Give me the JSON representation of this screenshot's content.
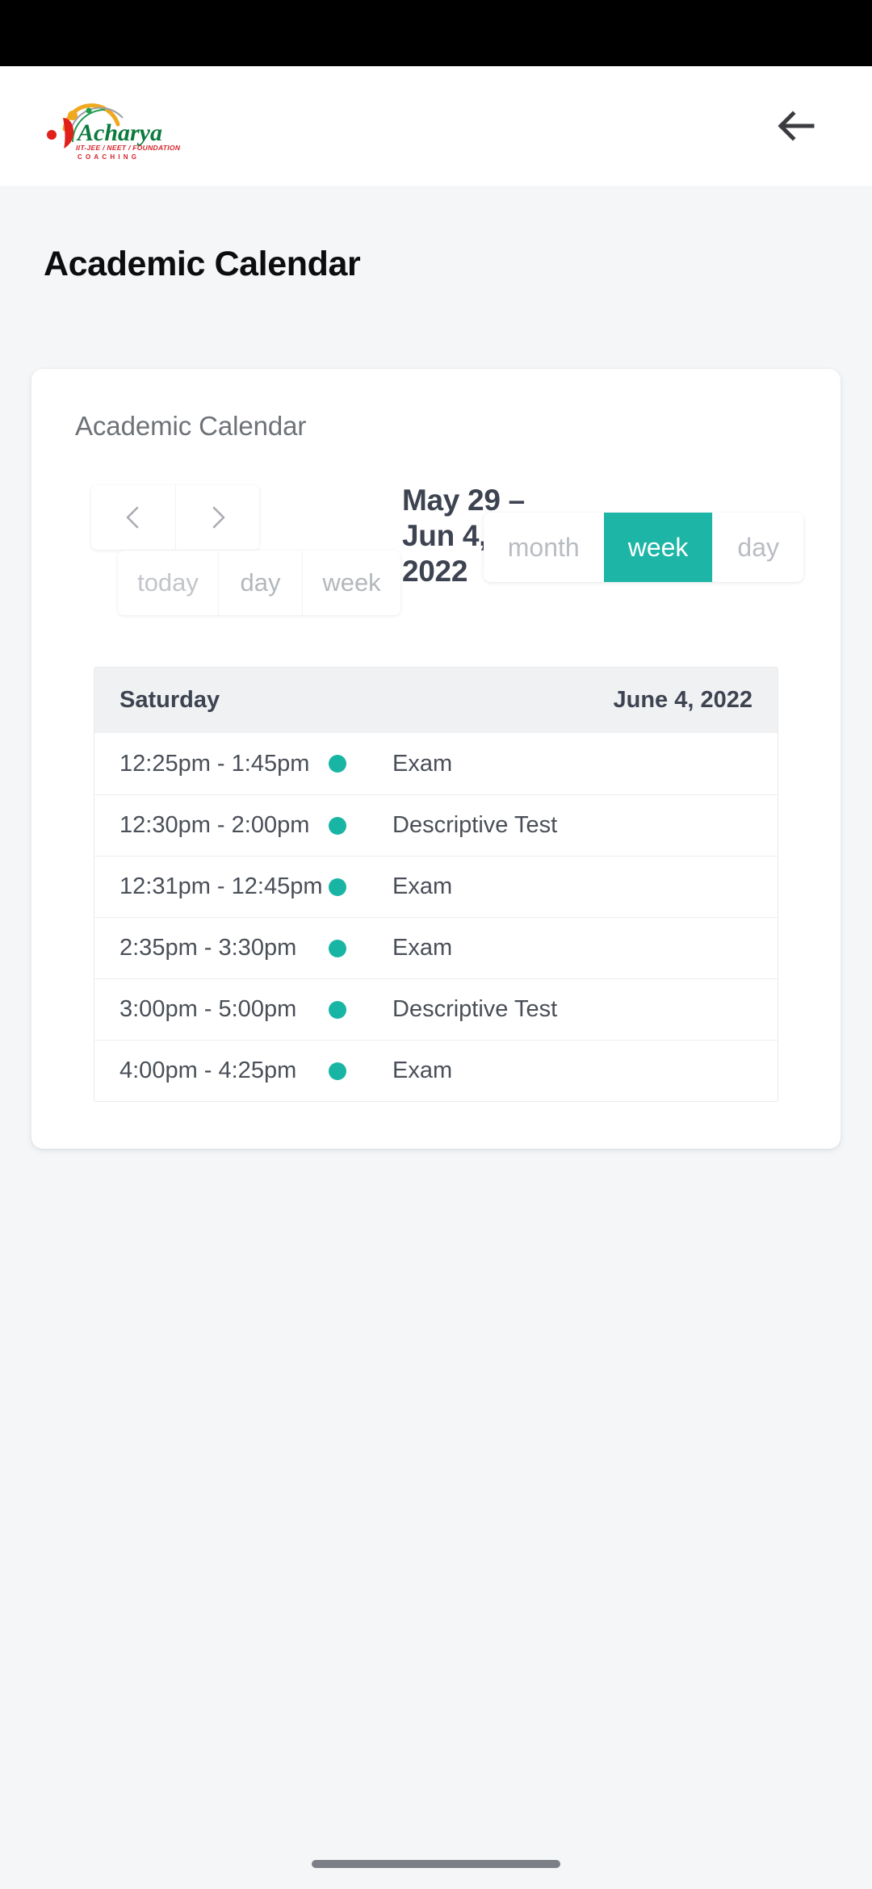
{
  "status_bar": {
    "background": "#000000"
  },
  "app_bar": {
    "logo": {
      "name": "acharya-logo",
      "wordmark": "Acharya",
      "tagline": "IIT-JEE / NEET / FOUNDATION",
      "subtagline": "C O A C H I N G",
      "wordmark_color": "#0b7a3e",
      "tagline_color": "#d6232a",
      "accent_red": "#e0201b",
      "accent_yellow": "#f0a81e",
      "accent_green": "#1f9d4d"
    },
    "back_icon": "arrow-left-icon",
    "back_icon_color": "#3a3c3f"
  },
  "page": {
    "title": "Academic Calendar",
    "background": "#f4f6f8"
  },
  "card": {
    "subtitle": "Academic Calendar",
    "background": "#ffffff"
  },
  "toolbar": {
    "prev_icon": "chevron-left-icon",
    "next_icon": "chevron-right-icon",
    "today_label": "today",
    "day_label": "day",
    "week_label": "week",
    "range_title": "May 29 – Jun 4, 2022",
    "views": [
      {
        "label": "month",
        "active": false
      },
      {
        "label": "week",
        "active": true
      },
      {
        "label": "day",
        "active": false
      }
    ],
    "active_color": "#1db5a6",
    "inactive_color": "#b9bcc1"
  },
  "events_table": {
    "header": {
      "day_name": "Saturday",
      "day_date": "June 4, 2022",
      "background": "#f0f1f2"
    },
    "dot_color": "#19b5a4",
    "rows": [
      {
        "time": "12:25pm - 1:45pm",
        "title": "Exam"
      },
      {
        "time": "12:30pm - 2:00pm",
        "title": "Descriptive Test"
      },
      {
        "time": "12:31pm - 12:45pm",
        "title": "Exam"
      },
      {
        "time": "2:35pm - 3:30pm",
        "title": "Exam"
      },
      {
        "time": "3:00pm - 5:00pm",
        "title": "Descriptive Test"
      },
      {
        "time": "4:00pm - 4:25pm",
        "title": "Exam"
      }
    ]
  },
  "system_nav": {
    "gesture_bar_color": "#7c7f85"
  }
}
